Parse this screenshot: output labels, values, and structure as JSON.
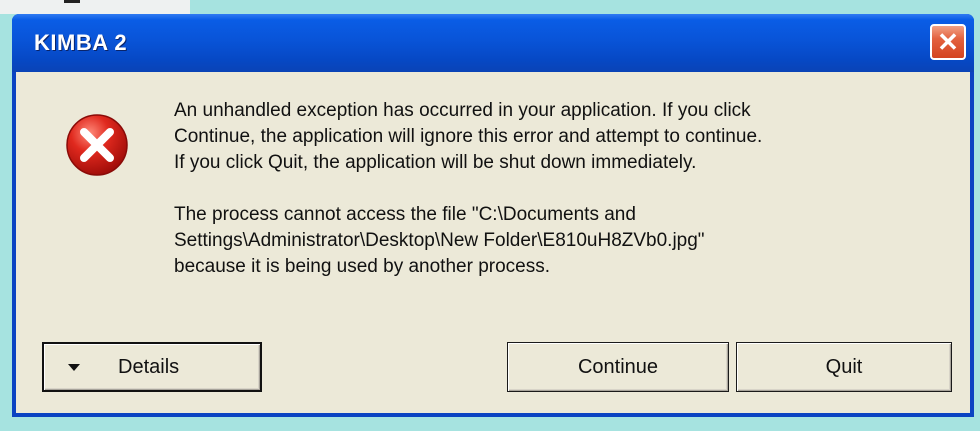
{
  "window": {
    "title": "KIMBA 2",
    "close_glyph": "✕"
  },
  "message": {
    "paragraph1": "An unhandled exception has occurred in your application. If you click\nContinue, the application will ignore this error and attempt to continue.\nIf you click Quit, the application will be shut down immediately.",
    "paragraph2": "The process cannot access the file \"C:\\Documents and\nSettings\\Administrator\\Desktop\\New Folder\\E810uH8ZVb0.jpg\"\nbecause it is being used by another process."
  },
  "buttons": {
    "details_label": "Details",
    "continue_label": "Continue",
    "quit_label": "Quit"
  },
  "icons": {
    "error": "error-icon",
    "close": "close-icon",
    "details_arrow": "chevron-down-icon"
  },
  "colors": {
    "titlebar": "#0954d8",
    "client_bg": "#ece9d8",
    "close_button": "#d4441f",
    "error_red": "#d8231c",
    "desktop": "#a6e3e0"
  }
}
